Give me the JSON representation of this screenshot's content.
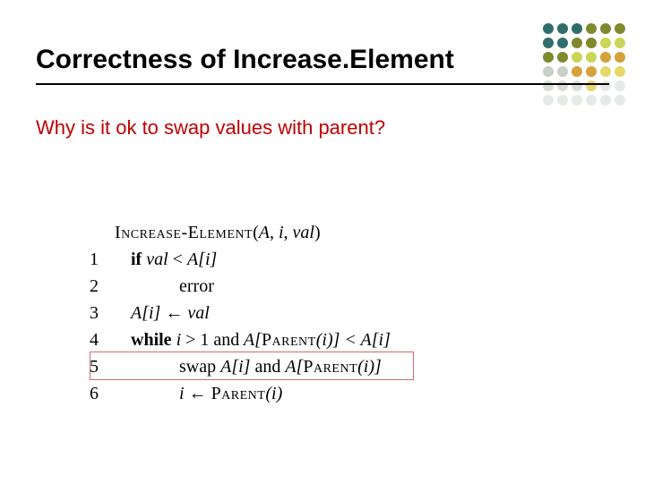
{
  "title": "Correctness of Increase.Element",
  "subtitle": "Why is it ok to swap values with parent?",
  "algo": {
    "fn_name": "Increase-Element",
    "args_open": "(",
    "args_A": "A",
    "args_c1": ", ",
    "args_i": "i",
    "args_c2": ", ",
    "args_val": "val",
    "args_close": ")",
    "kw_if": "if",
    "kw_while": "while",
    "kw_and": "and",
    "l1_num": "1",
    "l1_val": " val ",
    "l1_lt": "< ",
    "l1_Ai": "A[i]",
    "l2_num": "2",
    "l2_txt": "error",
    "l3_num": "3",
    "l3_Ai": "A[i] ",
    "l3_arrow": "← ",
    "l3_val": "val",
    "l4_num": "4",
    "l4_i": " i ",
    "l4_gt1": "> 1 ",
    "l4_Ap_open": " A[",
    "l4_parent": "Parent",
    "l4_Ap_mid": "(i)] < ",
    "l4_Ai": "A[i]",
    "l5_num": "5",
    "l5_swap": "swap ",
    "l5_Ai": "A[i] ",
    "l5_and_word": "and ",
    "l5_Ap_open": "A[",
    "l5_parent": "Parent",
    "l5_Ap_close": "(i)]",
    "l6_num": "6",
    "l6_i": "i ",
    "l6_arrow": "← ",
    "l6_parent": "Parent",
    "l6_close": "(i)"
  }
}
